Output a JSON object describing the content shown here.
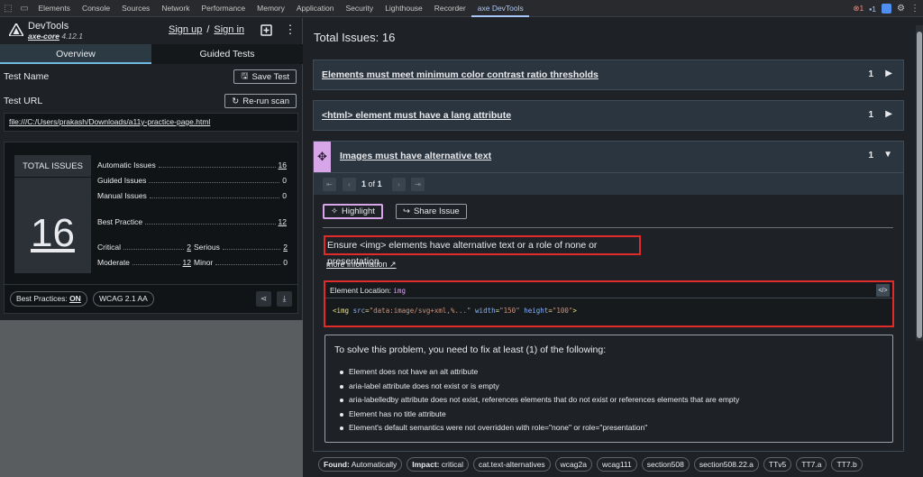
{
  "devtools": {
    "tabs": [
      "Elements",
      "Console",
      "Sources",
      "Network",
      "Performance",
      "Memory",
      "Application",
      "Security",
      "Lighthouse",
      "Recorder",
      "axe DevTools"
    ],
    "active_tab": "axe DevTools",
    "error_count": "1",
    "message_count": "1",
    "icons": [
      "inspect-icon",
      "device-toolbar-icon",
      "error-icon",
      "message-icon",
      "extension-icon",
      "settings-icon",
      "more-icon"
    ]
  },
  "left": {
    "brand": "DevTools",
    "brand_sub_name": "axe-core",
    "brand_sub_version": "4.12.1",
    "sign_up": "Sign up",
    "sign_in": "Sign in",
    "sep": "/",
    "tabs": {
      "overview": "Overview",
      "guided": "Guided Tests"
    },
    "test_name_label": "Test Name",
    "save_test": "Save Test",
    "test_url_label": "Test URL",
    "rerun_scan": "Re-run scan",
    "url": "file:///C:/Users/prakash/Downloads/a11y-practice-page.html",
    "total_issues_label": "TOTAL ISSUES",
    "total_issues": "16",
    "stats": [
      {
        "label": "Automatic Issues",
        "value": "16"
      },
      {
        "label": "Guided Issues",
        "value": "0"
      },
      {
        "label": "Manual Issues",
        "value": "0"
      },
      {
        "label": "Best Practice",
        "value": "12"
      }
    ],
    "impact": [
      {
        "label": "Critical",
        "value": "2"
      },
      {
        "label": "Serious",
        "value": "2"
      },
      {
        "label": "Moderate",
        "value": "12"
      },
      {
        "label": "Minor",
        "value": "0"
      }
    ],
    "best_practices_label": "Best Practices:",
    "best_practices_value": "ON",
    "wcag_label": "WCAG 2.1 AA"
  },
  "right": {
    "title": "Total Issues: 16",
    "issues": [
      {
        "title": "Elements must meet minimum color contrast ratio thresholds",
        "count": "1"
      },
      {
        "title": "<html> element must have a lang attribute",
        "count": "1"
      },
      {
        "title": "Images must have alternative text",
        "count": "1"
      }
    ],
    "pager_page": "1",
    "pager_of": "of",
    "pager_total": "1",
    "highlight": "Highlight",
    "share_issue": "Share Issue",
    "description": "Ensure <img> elements have alternative text or a role of none or presentation",
    "more_information": "more information",
    "element_location_label": "Element Location:",
    "element_location_selector": "img",
    "code_tag": "<img",
    "code_attr1": "src",
    "code_val1": "\"data:image/svg+xml,%...\"",
    "code_attr2": "width",
    "code_val2": "\"150\"",
    "code_attr3": "height",
    "code_val3": "\"100\"",
    "code_end": ">",
    "fix_title": "To solve this problem, you need to fix at least (1) of the following:",
    "fixes": [
      "Element does not have an alt attribute",
      "aria-label attribute does not exist or is empty",
      "aria-labelledby attribute does not exist, references elements that do not exist or references elements that are empty",
      "Element has no title attribute",
      "Element's default semantics were not overridden with role=\"none\" or role=\"presentation\""
    ],
    "tags": [
      {
        "k": "Found:",
        "v": "Automatically"
      },
      {
        "k": "Impact:",
        "v": "critical"
      },
      {
        "k": "",
        "v": "cat.text-alternatives"
      },
      {
        "k": "",
        "v": "wcag2a"
      },
      {
        "k": "",
        "v": "wcag111"
      },
      {
        "k": "",
        "v": "section508"
      },
      {
        "k": "",
        "v": "section508.22.a"
      },
      {
        "k": "",
        "v": "TTv5"
      },
      {
        "k": "",
        "v": "TT7.a"
      },
      {
        "k": "",
        "v": "TT7.b"
      }
    ]
  },
  "colors": {
    "accent": "#a8c7fa",
    "highlight_border": "#d6a6e8",
    "annotation_red": "#e02b2b"
  }
}
